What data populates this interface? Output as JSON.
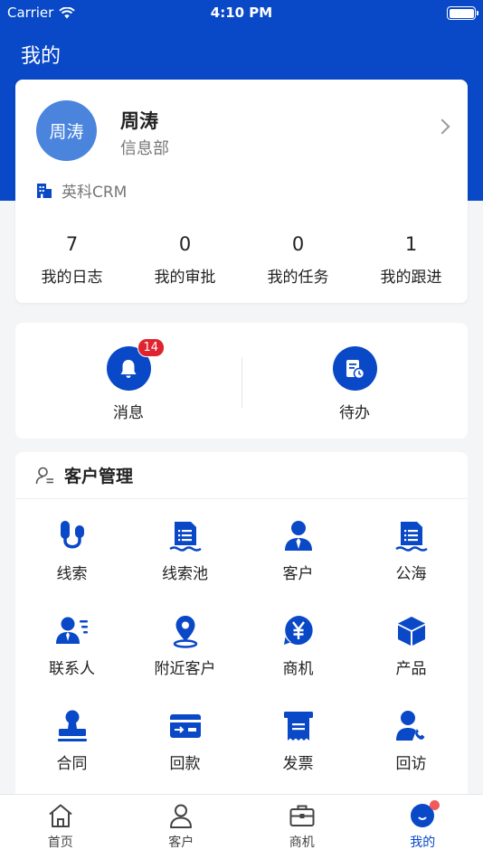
{
  "status": {
    "carrier": "Carrier",
    "time": "4:10 PM"
  },
  "page": {
    "title": "我的"
  },
  "profile": {
    "avatar_text": "周涛",
    "name": "周涛",
    "department": "信息部",
    "company": "英科CRM",
    "stats": [
      {
        "value": "7",
        "label": "我的日志"
      },
      {
        "value": "0",
        "label": "我的审批"
      },
      {
        "value": "0",
        "label": "我的任务"
      },
      {
        "value": "1",
        "label": "我的跟进"
      }
    ]
  },
  "quick": {
    "items": [
      {
        "label": "消息",
        "icon": "bell-icon",
        "badge": "14"
      },
      {
        "label": "待办",
        "icon": "todo-clock-icon"
      }
    ]
  },
  "management": {
    "title": "客户管理",
    "items": [
      {
        "label": "线索",
        "icon": "lead-icon"
      },
      {
        "label": "线索池",
        "icon": "lead-pool-icon"
      },
      {
        "label": "客户",
        "icon": "customer-icon"
      },
      {
        "label": "公海",
        "icon": "public-sea-icon"
      },
      {
        "label": "联系人",
        "icon": "contacts-icon"
      },
      {
        "label": "附近客户",
        "icon": "location-pin-icon"
      },
      {
        "label": "商机",
        "icon": "opportunity-yen-icon"
      },
      {
        "label": "产品",
        "icon": "product-cube-icon"
      },
      {
        "label": "合同",
        "icon": "contract-stamp-icon"
      },
      {
        "label": "回款",
        "icon": "payment-card-icon"
      },
      {
        "label": "发票",
        "icon": "invoice-icon"
      },
      {
        "label": "回访",
        "icon": "revisit-phone-icon"
      }
    ]
  },
  "tabbar": {
    "tabs": [
      {
        "label": "首页",
        "icon": "home-icon"
      },
      {
        "label": "客户",
        "icon": "person-icon"
      },
      {
        "label": "商机",
        "icon": "briefcase-icon"
      },
      {
        "label": "我的",
        "icon": "me-face-icon",
        "active": true
      }
    ]
  },
  "colors": {
    "primary": "#0948c6",
    "badge": "#e0242f",
    "avatar": "#4a84dd"
  }
}
